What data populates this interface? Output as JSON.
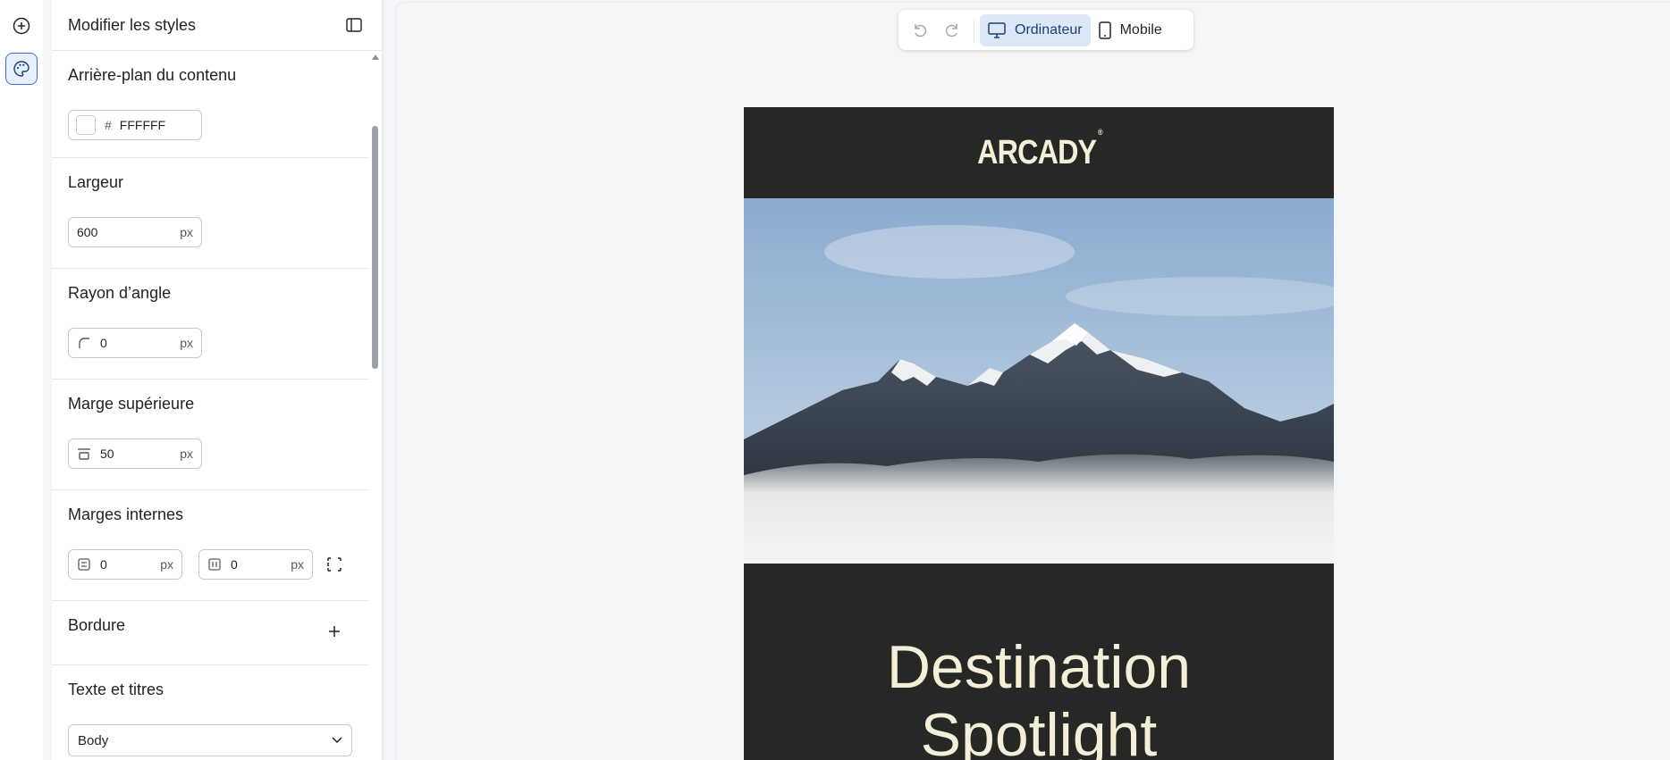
{
  "panel": {
    "title": "Modifier les styles",
    "sections": {
      "background": {
        "label": "Arrière-plan du contenu",
        "hash": "#",
        "value": "FFFFFF"
      },
      "width": {
        "label": "Largeur",
        "value": "600",
        "unit": "px"
      },
      "radius": {
        "label": "Rayon d’angle",
        "value": "0",
        "unit": "px"
      },
      "margin_top": {
        "label": "Marge supérieure",
        "value": "50",
        "unit": "px"
      },
      "padding": {
        "label": "Marges internes",
        "vertical": "0",
        "horizontal": "0",
        "unit": "px"
      },
      "border": {
        "label": "Bordure"
      },
      "text": {
        "label": "Texte et titres",
        "select_value": "Body"
      }
    }
  },
  "toolbar": {
    "desktop_label": "Ordinateur",
    "mobile_label": "Mobile"
  },
  "email": {
    "logo": "ARCADY",
    "logo_mark": "®",
    "headline_line1": "Destination",
    "headline_line2": "Spotlight"
  },
  "colors": {
    "accent": "#3b74d6",
    "email_bg": "#272725",
    "email_text": "#f3efd8"
  }
}
